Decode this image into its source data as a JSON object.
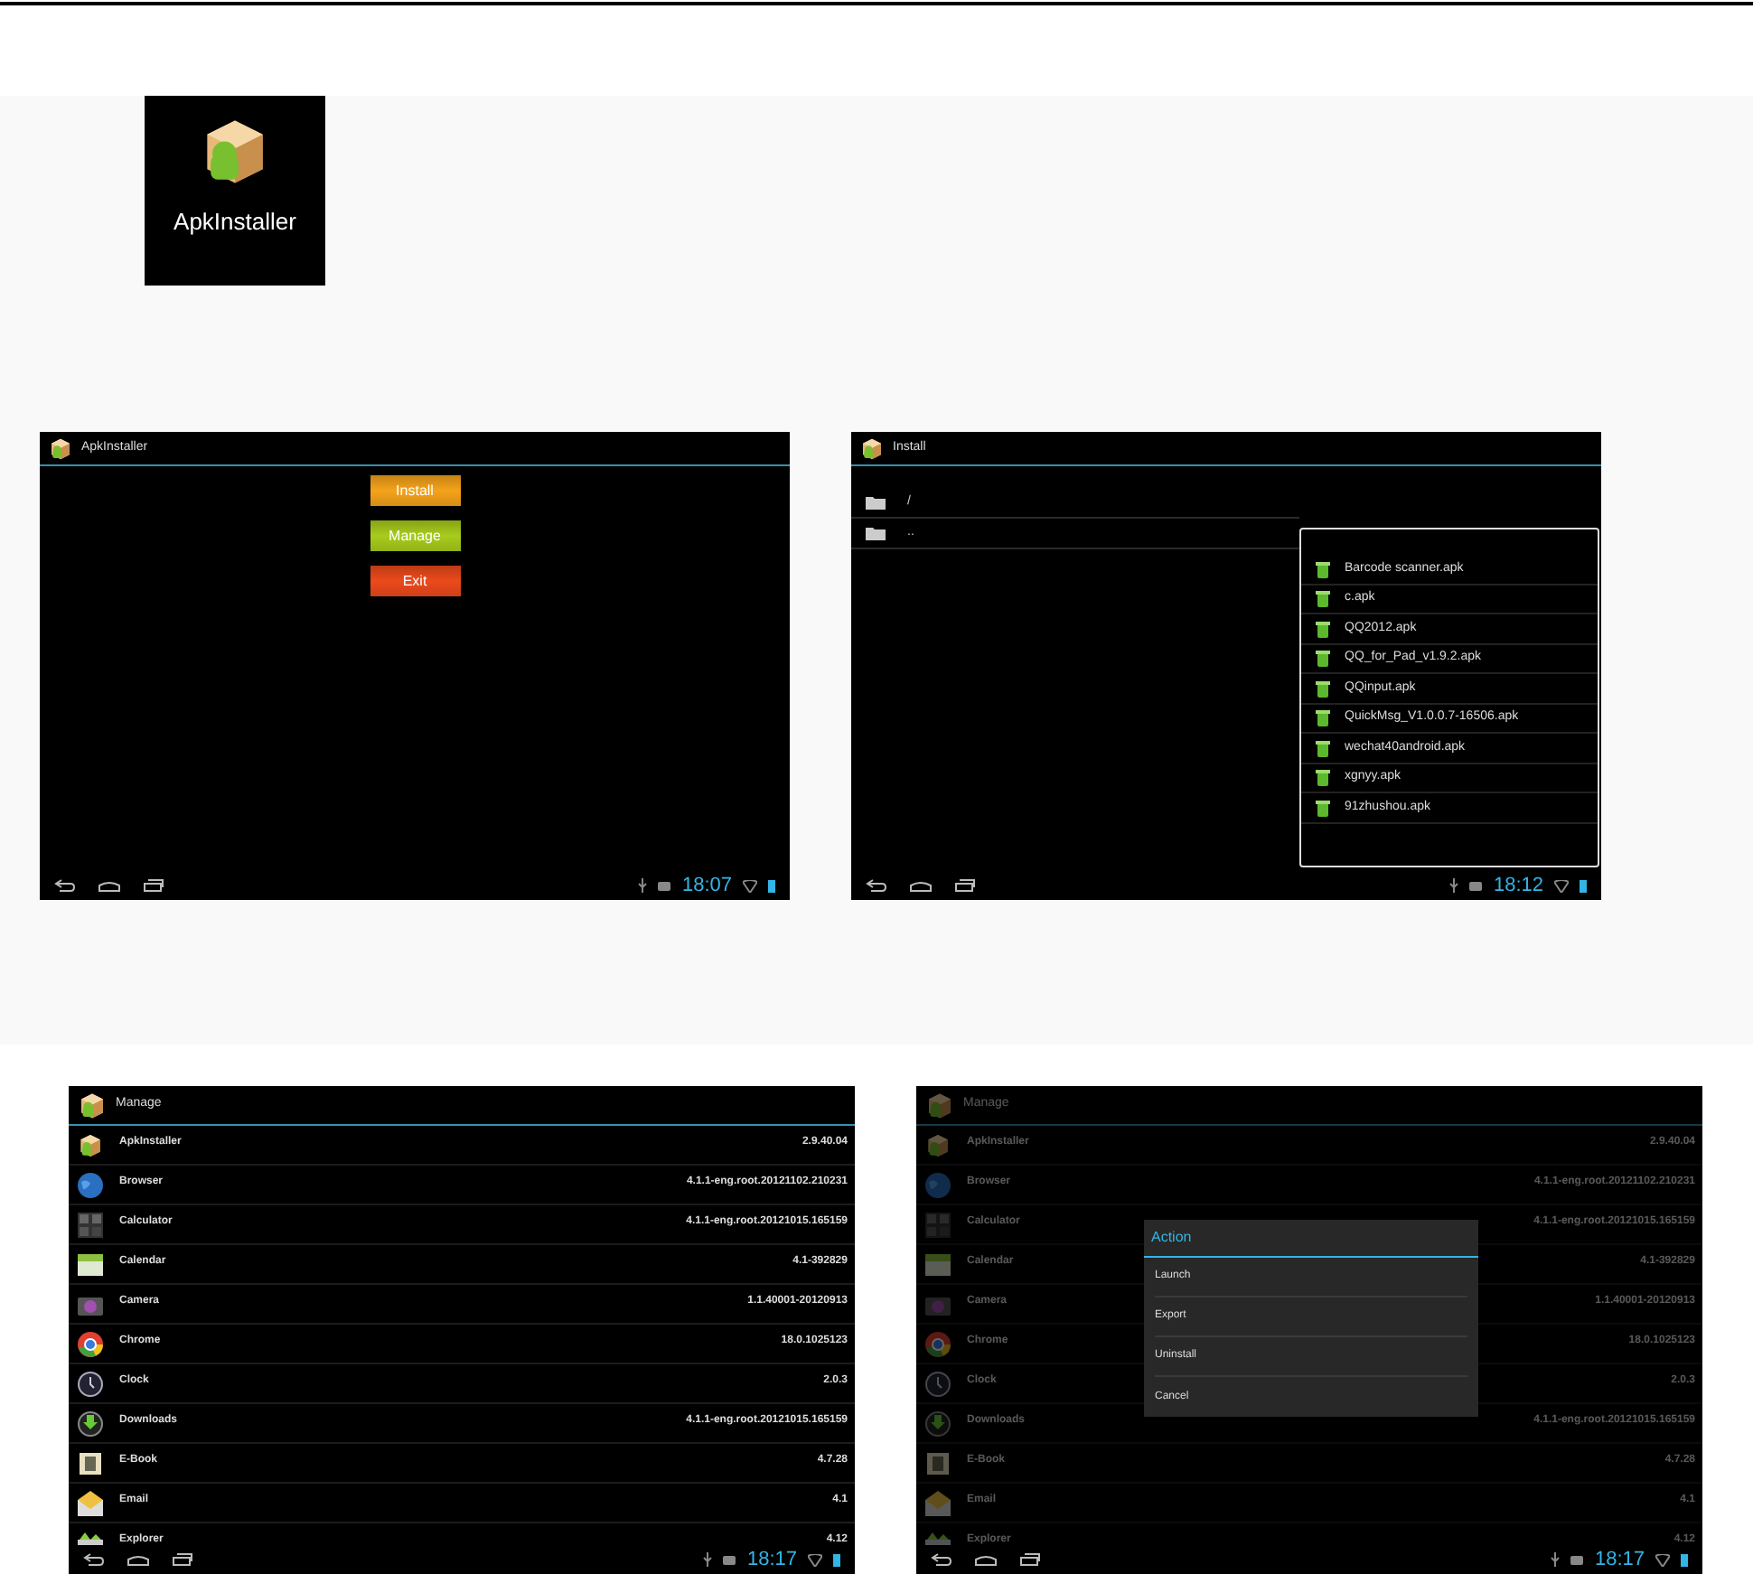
{
  "launcher_icon": {
    "label": "ApkInstaller"
  },
  "screens": [
    {
      "kind": "menu",
      "title": "ApkInstaller",
      "clock": "18:07",
      "buttons": [
        {
          "label": "Install",
          "color": "#f5a31a"
        },
        {
          "label": "Manage",
          "color": "#a8cc1c"
        },
        {
          "label": "Exit",
          "color": "#ec4a1c"
        }
      ]
    },
    {
      "kind": "install",
      "title": "Install",
      "clock": "18:12",
      "folders": [
        "/",
        ".."
      ],
      "files": [
        "Barcode scanner.apk",
        "c.apk",
        "QQ2012.apk",
        "QQ_for_Pad_v1.9.2.apk",
        "QQinput.apk",
        "QuickMsg_V1.0.0.7-16506.apk",
        "wechat40android.apk",
        "xgnyy.apk",
        "91zhushou.apk"
      ]
    },
    {
      "kind": "manage",
      "title": "Manage",
      "clock": "18:17",
      "apps": [
        {
          "name": "ApkInstaller",
          "version": "2.9.40.04"
        },
        {
          "name": "Browser",
          "version": "4.1.1-eng.root.20121102.210231"
        },
        {
          "name": "Calculator",
          "version": "4.1.1-eng.root.20121015.165159"
        },
        {
          "name": "Calendar",
          "version": "4.1-392829"
        },
        {
          "name": "Camera",
          "version": "1.1.40001-20120913"
        },
        {
          "name": "Chrome",
          "version": "18.0.1025123"
        },
        {
          "name": "Clock",
          "version": "2.0.3"
        },
        {
          "name": "Downloads",
          "version": "4.1.1-eng.root.20121015.165159"
        },
        {
          "name": "E-Book",
          "version": "4.7.28"
        },
        {
          "name": "Email",
          "version": "4.1"
        },
        {
          "name": "Explorer",
          "version": "4.12"
        }
      ]
    },
    {
      "kind": "manage",
      "title": "Manage",
      "clock": "18:17",
      "apps": [
        {
          "name": "ApkInstaller",
          "version": "2.9.40.04"
        },
        {
          "name": "Browser",
          "version": "4.1.1-eng.root.20121102.210231"
        },
        {
          "name": "Calculator",
          "version": "4.1.1-eng.root.20121015.165159"
        },
        {
          "name": "Calendar",
          "version": "4.1-392829"
        },
        {
          "name": "Camera",
          "version": "1.1.40001-20120913"
        },
        {
          "name": "Chrome",
          "version": "18.0.1025123"
        },
        {
          "name": "Clock",
          "version": "2.0.3"
        },
        {
          "name": "Downloads",
          "version": "4.1.1-eng.root.20121015.165159"
        },
        {
          "name": "E-Book",
          "version": "4.7.28"
        },
        {
          "name": "Email",
          "version": "4.1"
        },
        {
          "name": "Explorer",
          "version": "4.12"
        }
      ],
      "dialog": {
        "title": "Action",
        "options": [
          "Launch",
          "Export",
          "Uninstall",
          "Cancel"
        ]
      }
    }
  ]
}
